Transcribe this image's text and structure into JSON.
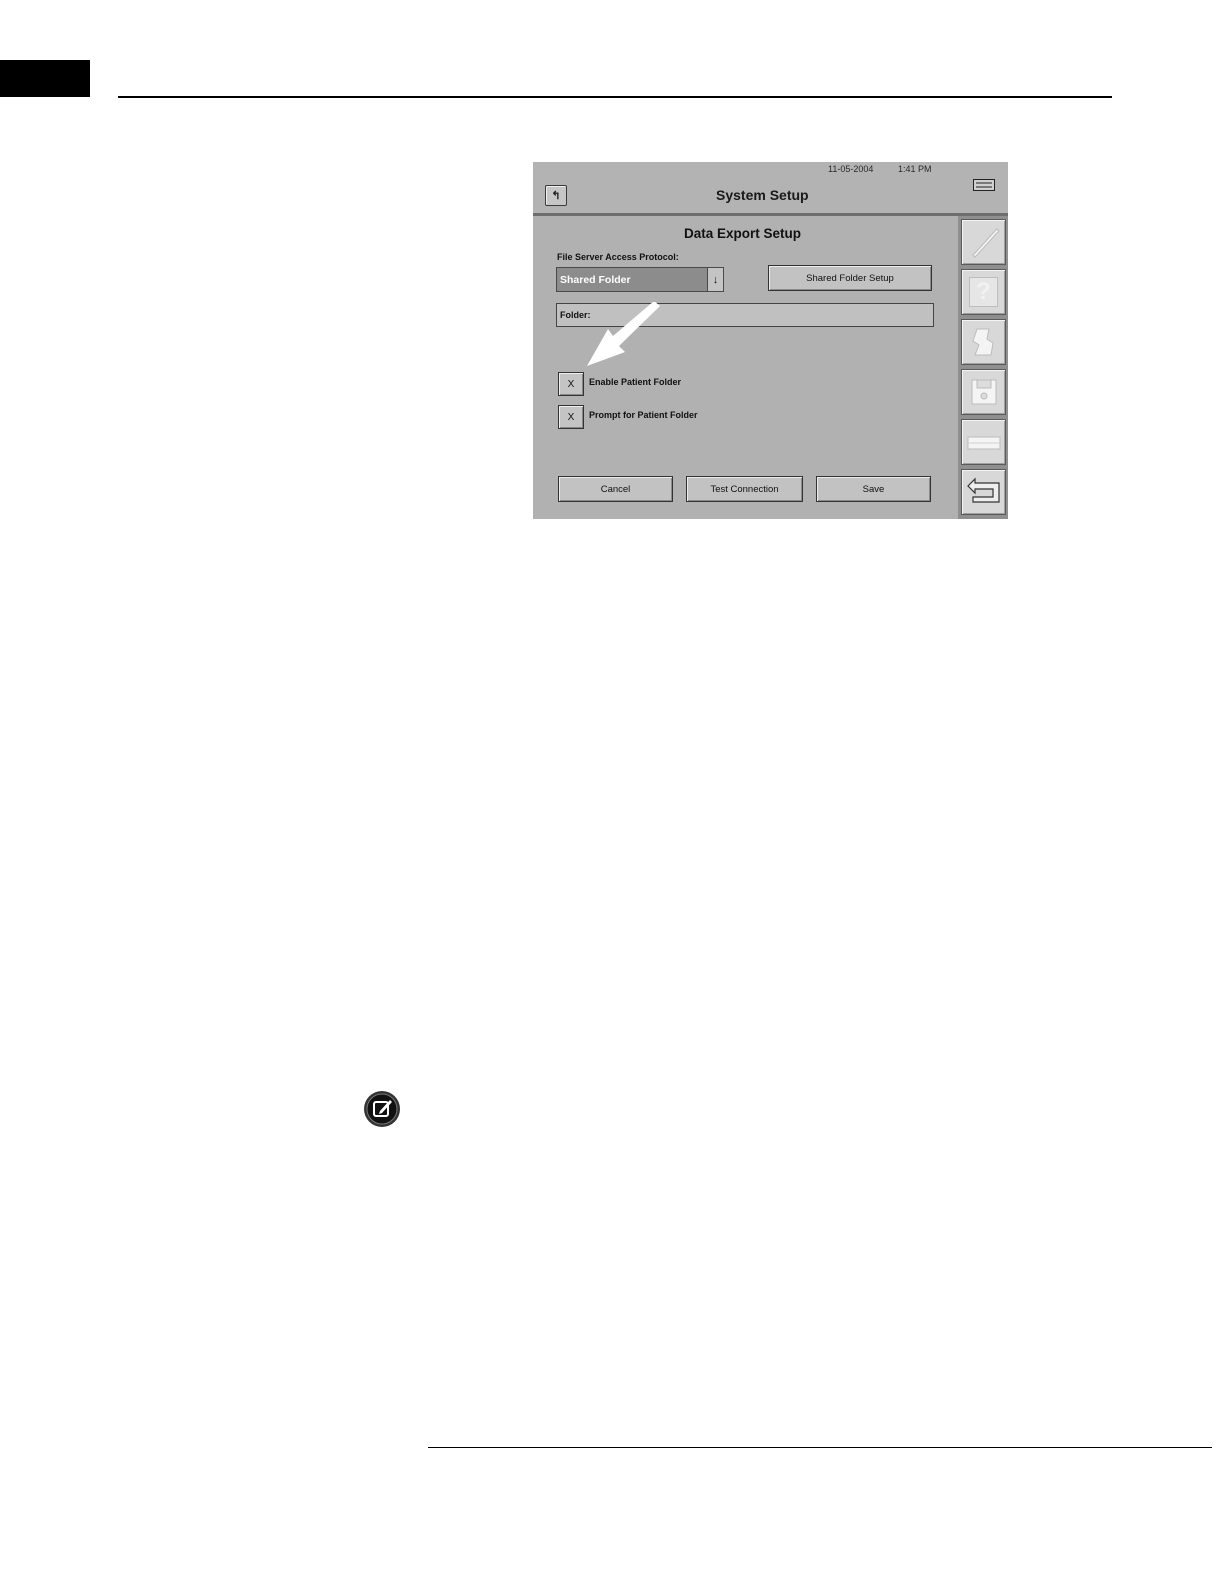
{
  "screen": {
    "date": "11-05-2004",
    "time": "1:41 PM",
    "title": "System Setup",
    "back_glyph": "↰",
    "panel_title": "Data Export Setup",
    "protocol_label": "File Server Access Protocol:",
    "protocol_value": "Shared Folder",
    "dropdown_glyph": "↓",
    "shared_folder_setup": "Shared Folder Setup",
    "folder_label": "Folder:",
    "checkboxes": [
      {
        "label": "Enable Patient Folder",
        "mark": "X"
      },
      {
        "label": "Prompt for Patient Folder",
        "mark": "X"
      }
    ],
    "buttons": {
      "cancel": "Cancel",
      "test_connection": "Test Connection",
      "save": "Save"
    },
    "sidebar_icons": [
      "pen-icon",
      "help-icon",
      "print-icon",
      "save-disk-icon",
      "tray-icon",
      "return-arrow-icon"
    ],
    "help_glyph": "?"
  }
}
